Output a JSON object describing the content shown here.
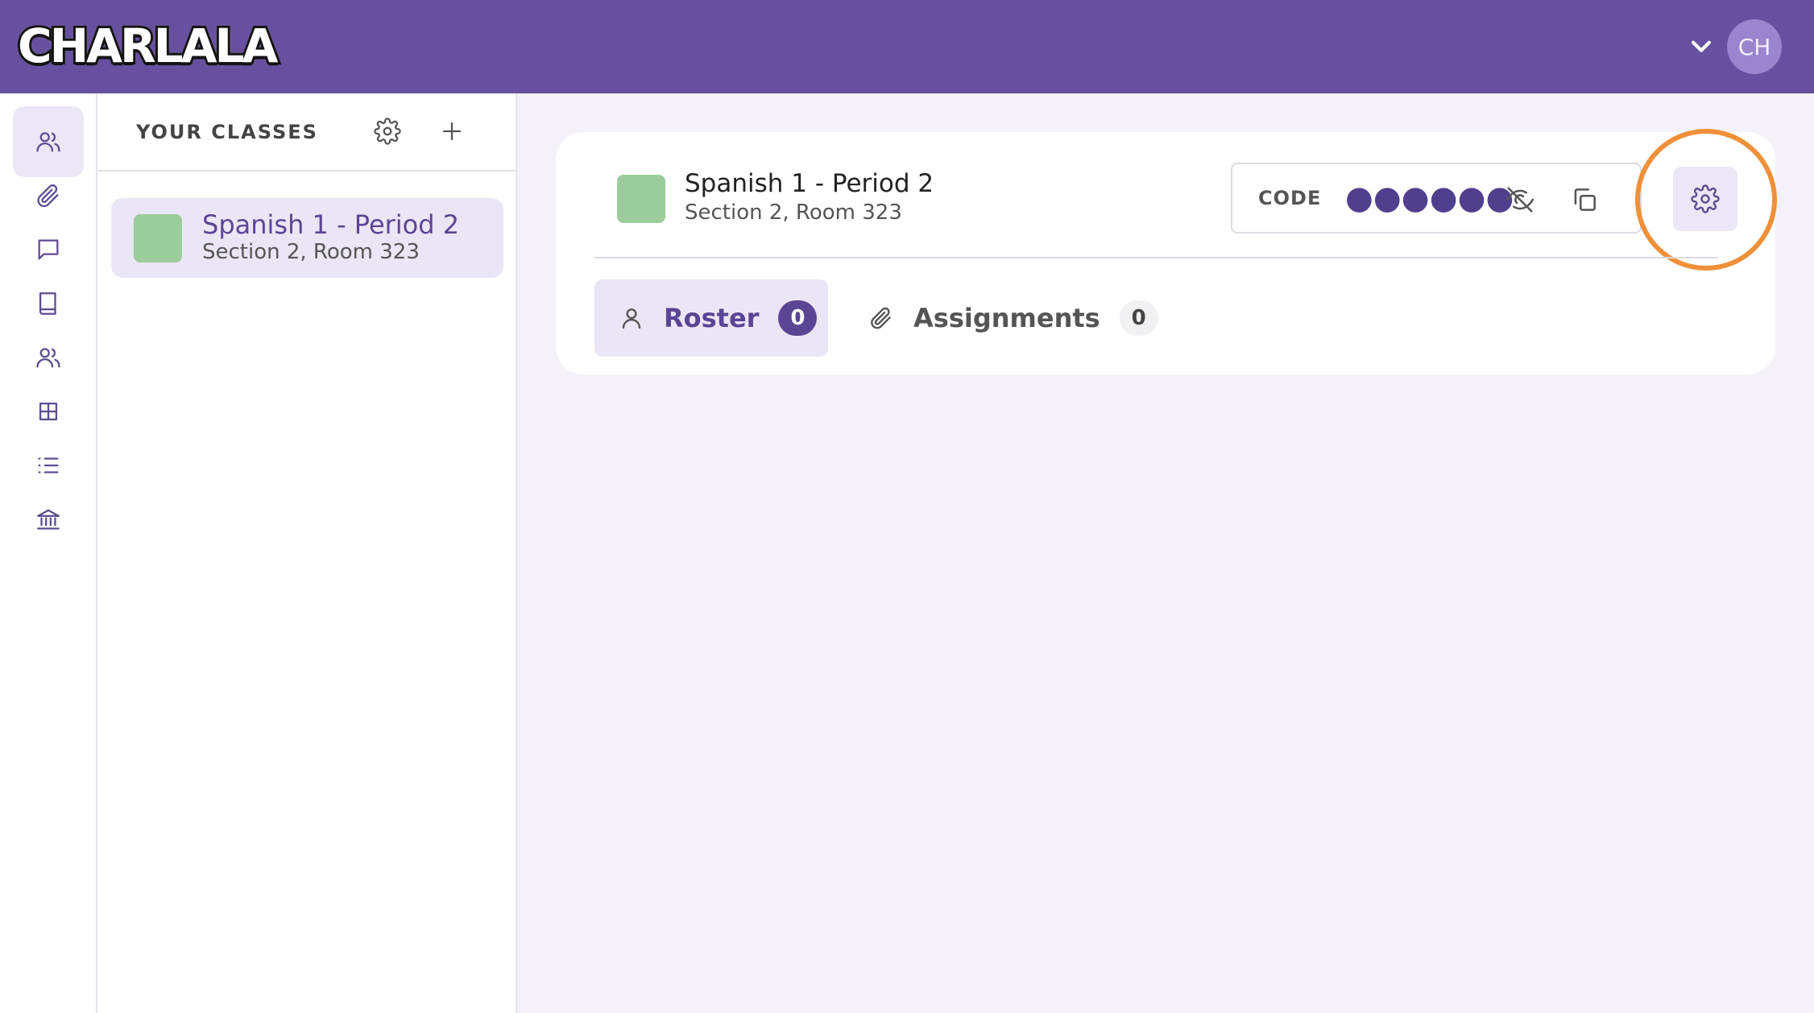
{
  "header": {
    "logo_text": "CHARLALA",
    "user_initials": "CH"
  },
  "class_panel": {
    "title": "YOUR CLASSES",
    "classes": [
      {
        "name": "Spanish 1 - Period 2",
        "subtitle": "Section 2, Room 323",
        "color": "#9ccc9c"
      }
    ]
  },
  "class_detail": {
    "name": "Spanish 1 - Period 2",
    "subtitle": "Section 2, Room 323",
    "color": "#9ccc9c",
    "code_label": "CODE",
    "code_value": "●●●●●●",
    "tabs": [
      {
        "label": "Roster",
        "count": "0",
        "icon": "user-icon",
        "active": true
      },
      {
        "label": "Assignments",
        "count": "0",
        "icon": "paperclip-icon",
        "active": false
      }
    ]
  },
  "colors": {
    "brand": "#67509f",
    "accent": "#5b4595",
    "highlight": "#f0903a"
  }
}
